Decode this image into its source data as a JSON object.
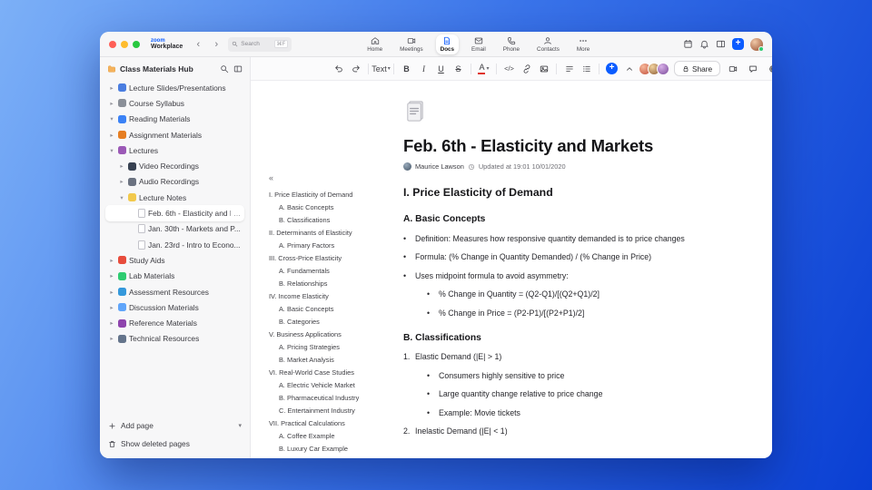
{
  "accent": "#0B5CFF",
  "titlebar": {
    "brand_top": "zoom",
    "brand_bottom": "Workplace",
    "search_placeholder": "Search",
    "search_shortcut": "⌘F",
    "tabs": [
      {
        "label": "Home"
      },
      {
        "label": "Meetings"
      },
      {
        "label": "Docs"
      },
      {
        "label": "Email"
      },
      {
        "label": "Phone"
      },
      {
        "label": "Contacts"
      },
      {
        "label": "More"
      }
    ]
  },
  "sidebar": {
    "title": "Class Materials Hub",
    "add_page_label": "Add page",
    "show_deleted_label": "Show deleted pages",
    "items": [
      {
        "id": "lecture-slides",
        "label": "Lecture Slides/Presentations",
        "level": 0,
        "chevron": "right",
        "icon": "presentation-icon",
        "color": "#4a7de0"
      },
      {
        "id": "course-syllabus",
        "label": "Course Syllabus",
        "level": 0,
        "chevron": "right",
        "icon": "syllabus-icon",
        "color": "#8a8f98"
      },
      {
        "id": "reading-materials",
        "label": "Reading Materials",
        "level": 0,
        "chevron": "down",
        "icon": "book-icon",
        "color": "#3b82f6"
      },
      {
        "id": "assignment-materials",
        "label": "Assignment Materials",
        "level": 0,
        "chevron": "right",
        "icon": "assignment-icon",
        "color": "#e67e22"
      },
      {
        "id": "lectures",
        "label": "Lectures",
        "level": 0,
        "chevron": "down",
        "icon": "lectures-icon",
        "color": "#9b59b6"
      },
      {
        "id": "video-recordings",
        "label": "Video Recordings",
        "level": 1,
        "chevron": "right",
        "icon": "video-icon",
        "color": "#374151"
      },
      {
        "id": "audio-recordings",
        "label": "Audio Recordings",
        "level": 1,
        "chevron": "right",
        "icon": "audio-icon",
        "color": "#6b7280"
      },
      {
        "id": "lecture-notes",
        "label": "Lecture Notes",
        "level": 1,
        "chevron": "down",
        "icon": "notes-icon",
        "color": "#f2c94c"
      },
      {
        "id": "feb-6-note",
        "label": "Feb. 6th - Elasticity and M...",
        "level": 2,
        "page": true,
        "icon": "page-icon",
        "selected": true
      },
      {
        "id": "jan-30-note",
        "label": "Jan. 30th - Markets and P...",
        "level": 2,
        "page": true,
        "icon": "page-icon"
      },
      {
        "id": "jan-23-note",
        "label": "Jan. 23rd - Intro to Econo...",
        "level": 2,
        "page": true,
        "icon": "page-icon"
      },
      {
        "id": "study-aids",
        "label": "Study Aids",
        "level": 0,
        "chevron": "right",
        "icon": "apple-icon",
        "color": "#e74c3c"
      },
      {
        "id": "lab-materials",
        "label": "Lab Materials",
        "level": 0,
        "chevron": "right",
        "icon": "lab-icon",
        "color": "#2ecc71"
      },
      {
        "id": "assessment-resources",
        "label": "Assessment Resources",
        "level": 0,
        "chevron": "right",
        "icon": "assessment-icon",
        "color": "#3498db"
      },
      {
        "id": "discussion-materials",
        "label": "Discussion Materials",
        "level": 0,
        "chevron": "right",
        "icon": "discussion-icon",
        "color": "#60a5fa"
      },
      {
        "id": "reference-materials",
        "label": "Reference Materials",
        "level": 0,
        "chevron": "right",
        "icon": "reference-icon",
        "color": "#8e44ad"
      },
      {
        "id": "technical-resources",
        "label": "Technical Resources",
        "level": 0,
        "chevron": "right",
        "icon": "technical-icon",
        "color": "#64748b"
      }
    ]
  },
  "toolbar": {
    "text_style_label": "Text",
    "bold_label": "B",
    "italic_label": "I",
    "underline_label": "U",
    "strike_label": "S",
    "color_label": "A",
    "code_label": "</>",
    "share_label": "Share"
  },
  "document": {
    "title": "Feb. 6th - Elasticity and Markets",
    "author": "Maurice Lawson",
    "updated": "Updated at 19:01 10/01/2020",
    "outline": [
      {
        "text": "I. Price Elasticity of Demand",
        "level": 0
      },
      {
        "text": "A. Basic Concepts",
        "level": 1
      },
      {
        "text": "B. Classifications",
        "level": 1
      },
      {
        "text": "II. Determinants of Elasticity",
        "level": 0
      },
      {
        "text": "A. Primary Factors",
        "level": 1
      },
      {
        "text": "III. Cross-Price Elasticity",
        "level": 0
      },
      {
        "text": "A. Fundamentals",
        "level": 1
      },
      {
        "text": "B. Relationships",
        "level": 1
      },
      {
        "text": "IV. Income Elasticity",
        "level": 0
      },
      {
        "text": "A. Basic Concepts",
        "level": 1
      },
      {
        "text": "B. Categories",
        "level": 1
      },
      {
        "text": "V. Business Applications",
        "level": 0
      },
      {
        "text": "A. Pricing Strategies",
        "level": 1
      },
      {
        "text": "B. Market Analysis",
        "level": 1
      },
      {
        "text": "VI. Real-World Case Studies",
        "level": 0
      },
      {
        "text": "A. Electric Vehicle Market",
        "level": 1
      },
      {
        "text": "B. Pharmaceutical Industry",
        "level": 1
      },
      {
        "text": "C. Entertainment Industry",
        "level": 1
      },
      {
        "text": "VII. Practical Calculations",
        "level": 0
      },
      {
        "text": "A. Coffee Example",
        "level": 1
      },
      {
        "text": "B. Luxury Car Example",
        "level": 1
      }
    ],
    "blocks": [
      {
        "t": "h2",
        "text": "I. Price Elasticity of Demand"
      },
      {
        "t": "h3",
        "text": "A. Basic Concepts"
      },
      {
        "t": "li",
        "lvl": 0,
        "text": "Definition: Measures how responsive quantity demanded is to price changes"
      },
      {
        "t": "li",
        "lvl": 0,
        "text": "Formula: (% Change in Quantity Demanded) / (% Change in Price)"
      },
      {
        "t": "li",
        "lvl": 0,
        "text": "Uses midpoint formula to avoid asymmetry:"
      },
      {
        "t": "li",
        "lvl": 1,
        "text": "% Change in Quantity = (Q2-Q1)/[(Q2+Q1)/2]"
      },
      {
        "t": "li",
        "lvl": 1,
        "text": "% Change in Price = (P2-P1)/[(P2+P1)/2]"
      },
      {
        "t": "h3",
        "text": "B. Classifications"
      },
      {
        "t": "num",
        "n": "1.",
        "text": "Elastic Demand (|E| > 1)"
      },
      {
        "t": "li",
        "lvl": 1,
        "text": "Consumers highly sensitive to price"
      },
      {
        "t": "li",
        "lvl": 1,
        "text": "Large quantity change relative to price change"
      },
      {
        "t": "li",
        "lvl": 1,
        "text": "Example: Movie tickets"
      },
      {
        "t": "num",
        "n": "2.",
        "text": "Inelastic Demand (|E| < 1)"
      }
    ]
  }
}
